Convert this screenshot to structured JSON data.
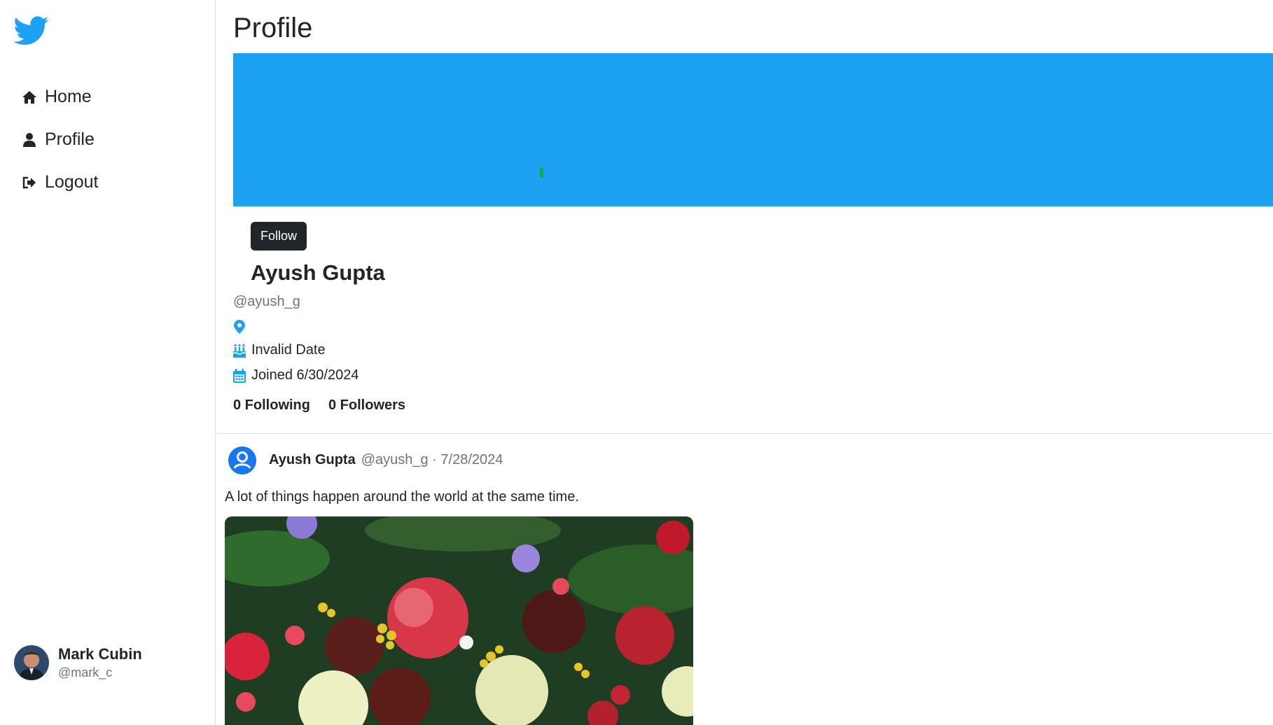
{
  "sidebar": {
    "logo": "twitter-bird-icon",
    "items": [
      {
        "label": "Home",
        "icon": "home-icon"
      },
      {
        "label": "Profile",
        "icon": "user-icon"
      },
      {
        "label": "Logout",
        "icon": "logout-icon"
      }
    ],
    "user": {
      "name": "Mark Cubin",
      "handle": "@mark_c"
    }
  },
  "main": {
    "title": "Profile",
    "banner_color": "#1da1f2",
    "follow_label": "Follow",
    "profile": {
      "name": "Ayush Gupta",
      "handle": "@ayush_g",
      "location": "",
      "birthday": "Invalid Date",
      "joined": "Joined 6/30/2024",
      "following": "0 Following",
      "followers": "0 Followers"
    },
    "post": {
      "author": "Ayush Gupta",
      "meta": "@ayush_g · 7/28/2024",
      "text": "A lot of things happen around the world at the same time."
    }
  },
  "colors": {
    "accent": "#1da1f2",
    "dark": "#212529",
    "muted": "#6c757d"
  }
}
